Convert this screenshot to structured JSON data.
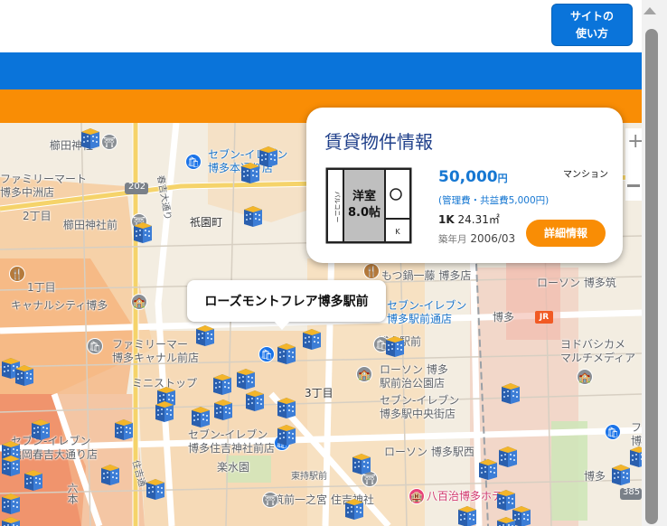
{
  "header": {
    "help_button": "サイトの\n使い方"
  },
  "map": {
    "labels": {
      "kushida_jinja": "櫛田神社",
      "family_mart_nakasu": "ファミリーマート\n博多中洲店",
      "seven_hakata_hondori": "セブン-イレブン\n博多本通り店",
      "nichome": "2丁目",
      "kushida_jinja_mae": "櫛田神社前",
      "gion_machi": "祇園町",
      "motsunabe": "もつ鍋一藤 博多店",
      "canal_city": "キャナルシティ博多",
      "itchome": "1丁目",
      "seven_hakata_ekimae": "セブン-イレブン\n博多駅前通店",
      "lawson_hakata_chikushi": "ローソン 博多筑",
      "family_mart_canal": "ファミリーマー\n博多キャナル前店",
      "hakata_ekimae_label": "博多駅前",
      "yodobashi": "ヨドバシカメ\nマルチメディア",
      "lawson_meiji": "ローソン 博多\n駅前治公園店",
      "sanchome": "3丁目",
      "mini_stop": "ミニストップ",
      "seven_chuogai": "セブン-イレブン\n博多駅中央街店",
      "seven_sumiyoshi": "セブン-イレブン\n博多住吉神社前店",
      "seven_kasuga": "セブン-イレブン\n福岡春吉大通り店",
      "rakusuien": "楽水園",
      "lawson_nishi": "ローソン 博多駅西",
      "higashi_ekimae": "東持駅前",
      "chikuzen_ichinomiya": "筑前一之宮 住吉神社",
      "yasaji": "八百治博多ホテル",
      "hakata": "博多",
      "bus_202": "202",
      "hakata_station": "博多",
      "hakata_station_jr": "JR",
      "route_385": "385",
      "rokku": "六本",
      "kasuga_dori": "春吉大通り",
      "sumiyoshi_dori": "住吉通",
      "right_partial": "フ\n博",
      "hakata_right": "博多"
    }
  },
  "tooltip": {
    "name": "ローズモントフレア博多駅前"
  },
  "card": {
    "title": "賃貸物件情報",
    "type": "マンション",
    "price": "50,000",
    "price_unit": "円",
    "management_fee": "(管理費・共益費5,000円)",
    "layout": "1K",
    "area": "24.31㎡",
    "built_label": "築年月",
    "built": "2006/03",
    "detail_button": "詳細情報",
    "floorplan_text": {
      "room": "洋室\n8.0帖",
      "balcony": "バルコニー",
      "kitchen": "K"
    }
  },
  "colors": {
    "accent_blue": "#0a74da",
    "accent_orange": "#f98d05",
    "title_navy": "#1f3f8a"
  },
  "icons": [
    "building-marker-icon",
    "shrine-icon",
    "convenience-store-icon",
    "school-icon",
    "shop-icon"
  ]
}
